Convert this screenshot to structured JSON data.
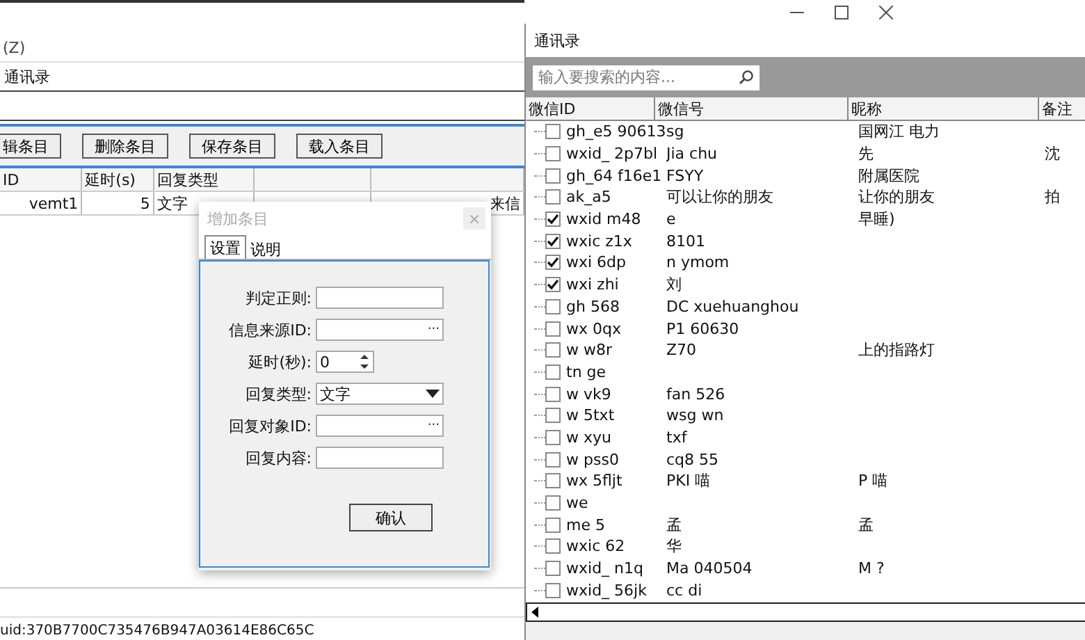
{
  "main_window": {
    "menu_hint": "(Z)",
    "contact_field": "通讯录",
    "buttons": [
      "辑条目",
      "删除条目",
      "保存条目",
      "载入条目"
    ],
    "table": {
      "columns": [
        "ID",
        "延时(s)",
        "回复类型",
        "",
        ""
      ],
      "rows": [
        [
          "vemt1",
          "5",
          "文字",
          "",
          "来信"
        ]
      ]
    },
    "status_bar": "uid:370B7700C735476B947A03614E86C65C"
  },
  "dialog": {
    "title": "增加条目",
    "close": "×",
    "disabled": true,
    "tabs": [
      {
        "label": "设置",
        "selected": true
      },
      {
        "label": "说明",
        "selected": false
      }
    ],
    "fields": [
      {
        "kind": "text",
        "label": "判定正则:"
      },
      {
        "kind": "browse",
        "label": "信息来源ID:",
        "button": "···"
      },
      {
        "kind": "spin",
        "label": "延时(秒):",
        "value": "0"
      },
      {
        "kind": "select",
        "label": "回复类型:",
        "value": "文字"
      },
      {
        "kind": "browse",
        "label": "回复对象ID:",
        "button": "···"
      },
      {
        "kind": "text",
        "label": "回复内容:"
      }
    ],
    "confirm": "确认"
  },
  "contacts_window": {
    "title": "通讯录",
    "search": {
      "placeholder": "输入要搜索的内容..."
    },
    "columns": [
      "微信ID",
      "微信号",
      "昵称",
      "备注"
    ],
    "rows": [
      {
        "checked": false,
        "cells": [
          "gh_e5 90613",
          "sg",
          "国网江 电力",
          ""
        ]
      },
      {
        "checked": false,
        "cells": [
          "wxid_ 2p7bl",
          "Jia chu",
          "先",
          "沈"
        ]
      },
      {
        "checked": false,
        "cells": [
          "gh_64 f16e1",
          "FSYY",
          "附属医院",
          ""
        ]
      },
      {
        "checked": false,
        "cells": [
          "ak_a5",
          "可以让你的朋友",
          "让你的朋友",
          "拍"
        ]
      },
      {
        "checked": true,
        "cells": [
          "wxid m48",
          "e",
          "早睡)",
          ""
        ]
      },
      {
        "checked": true,
        "cells": [
          "wxic z1x",
          "8101",
          "",
          ""
        ]
      },
      {
        "checked": true,
        "cells": [
          "wxi 6dp",
          "n ymom",
          "",
          ""
        ]
      },
      {
        "checked": true,
        "cells": [
          "wxi zhi",
          "刘",
          "",
          ""
        ]
      },
      {
        "checked": false,
        "cells": [
          "gh 568",
          "DC xuehuanghou",
          "",
          ""
        ]
      },
      {
        "checked": false,
        "cells": [
          "wx 0qx",
          "P1 60630",
          "",
          ""
        ]
      },
      {
        "checked": false,
        "cells": [
          "w w8r",
          "Z70",
          "上的指路灯",
          ""
        ]
      },
      {
        "checked": false,
        "cells": [
          "tn ge",
          "",
          "",
          ""
        ]
      },
      {
        "checked": false,
        "cells": [
          "w vk9",
          "fan 526",
          "",
          ""
        ]
      },
      {
        "checked": false,
        "cells": [
          "w 5txt",
          "wsg wn",
          "",
          ""
        ]
      },
      {
        "checked": false,
        "cells": [
          "w xyu",
          "txf",
          "",
          ""
        ]
      },
      {
        "checked": false,
        "cells": [
          "w pss0",
          "cq8 55",
          "",
          ""
        ]
      },
      {
        "checked": false,
        "cells": [
          "wx 5fljt",
          "PKI 喵",
          "P 喵",
          ""
        ]
      },
      {
        "checked": false,
        "cells": [
          "we",
          "",
          "",
          ""
        ]
      },
      {
        "checked": false,
        "cells": [
          "me 5",
          "孟",
          "孟",
          ""
        ]
      },
      {
        "checked": false,
        "cells": [
          "wxic 62",
          "华",
          "",
          ""
        ]
      },
      {
        "checked": false,
        "cells": [
          "wxid_ n1q",
          "Ma 040504",
          "M ?",
          ""
        ]
      },
      {
        "checked": false,
        "cells": [
          "wxid_ 56jk",
          "cc di",
          "",
          ""
        ]
      }
    ]
  }
}
